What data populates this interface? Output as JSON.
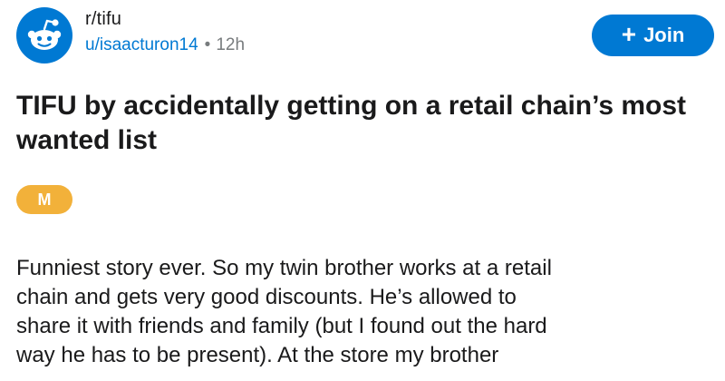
{
  "post": {
    "subreddit": "r/tifu",
    "username": "u/isaacturon14",
    "separator": "•",
    "age": "12h",
    "join_label": "Join",
    "join_icon": "+",
    "title": "TIFU by accidentally getting on a retail chain’s most wanted list",
    "flair": "M",
    "body": [
      "Funniest story ever. So my twin brother works at a retail",
      "chain and gets very good discounts. He’s allowed to",
      "share it with friends and family (but I found out the hard",
      "way he has to be present). At the store my brother"
    ]
  },
  "colors": {
    "accent": "#0079d3",
    "flair": "#f2b13a",
    "text": "#1a1a1b",
    "muted": "#787c7e"
  },
  "icons": {
    "subreddit_avatar": "reddit-snoo-icon",
    "join": "plus-icon"
  }
}
